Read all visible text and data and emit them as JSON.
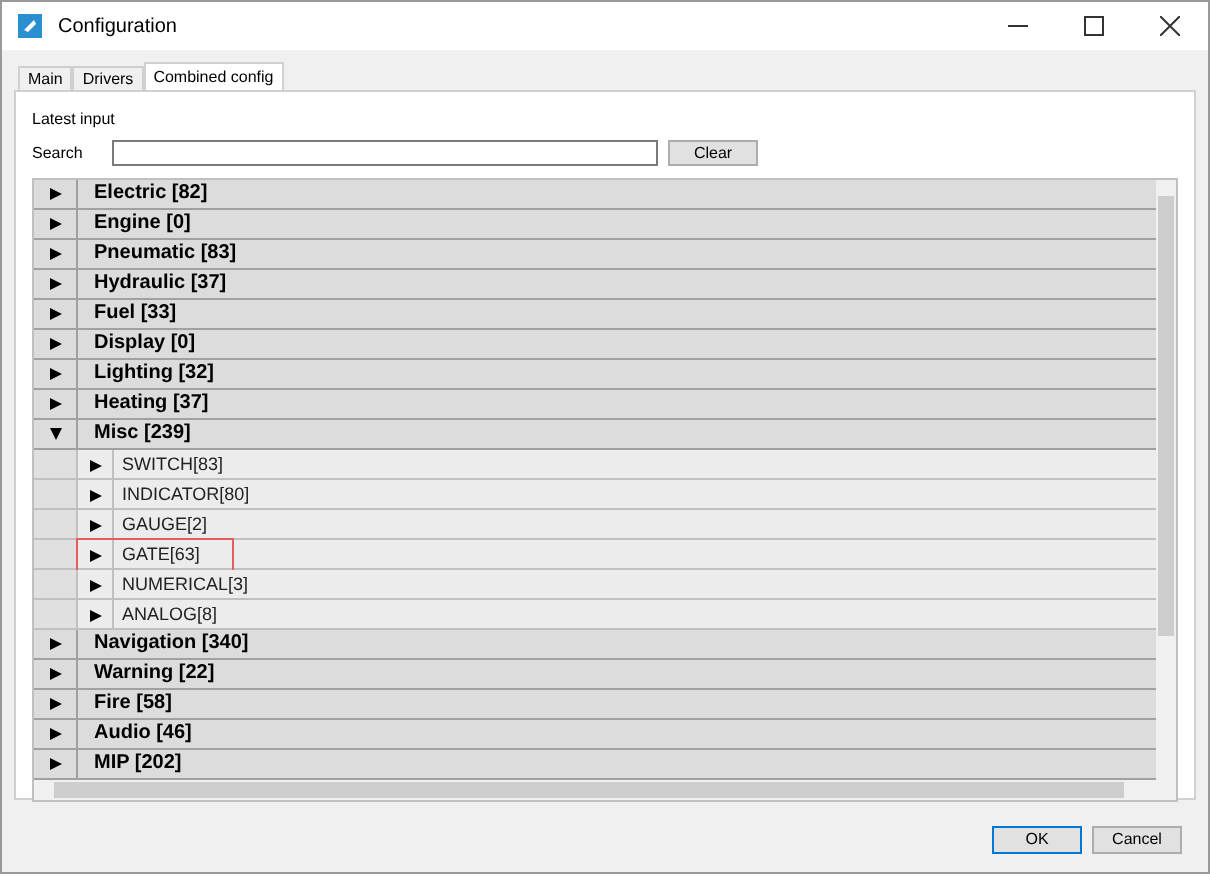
{
  "window": {
    "title": "Configuration"
  },
  "tabs": [
    {
      "label": "Main",
      "selected": false
    },
    {
      "label": "Drivers",
      "selected": false
    },
    {
      "label": "Combined config",
      "selected": true
    }
  ],
  "latest_input_label": "Latest input",
  "search": {
    "label": "Search"
  },
  "clear_button": "Clear",
  "groups": [
    {
      "name": "Electric [82]",
      "expanded": false
    },
    {
      "name": "Engine [0]",
      "expanded": false
    },
    {
      "name": "Pneumatic [83]",
      "expanded": false
    },
    {
      "name": "Hydraulic [37]",
      "expanded": false
    },
    {
      "name": "Fuel [33]",
      "expanded": false
    },
    {
      "name": "Display [0]",
      "expanded": false
    },
    {
      "name": "Lighting [32]",
      "expanded": false
    },
    {
      "name": "Heating [37]",
      "expanded": false
    },
    {
      "name": "Misc [239]",
      "expanded": true,
      "children": [
        {
          "name": "SWITCH[83]",
          "highlighted": false
        },
        {
          "name": "INDICATOR[80]",
          "highlighted": false
        },
        {
          "name": "GAUGE[2]",
          "highlighted": false
        },
        {
          "name": "GATE[63]",
          "highlighted": true
        },
        {
          "name": "NUMERICAL[3]",
          "highlighted": false
        },
        {
          "name": "ANALOG[8]",
          "highlighted": false
        }
      ]
    },
    {
      "name": "Navigation [340]",
      "expanded": false
    },
    {
      "name": "Warning [22]",
      "expanded": false
    },
    {
      "name": "Fire [58]",
      "expanded": false
    },
    {
      "name": "Audio [46]",
      "expanded": false
    },
    {
      "name": "MIP [202]",
      "expanded": false
    }
  ],
  "buttons": [
    {
      "label": "OK",
      "kind": "default"
    },
    {
      "label": "Cancel",
      "kind": "normal"
    }
  ]
}
